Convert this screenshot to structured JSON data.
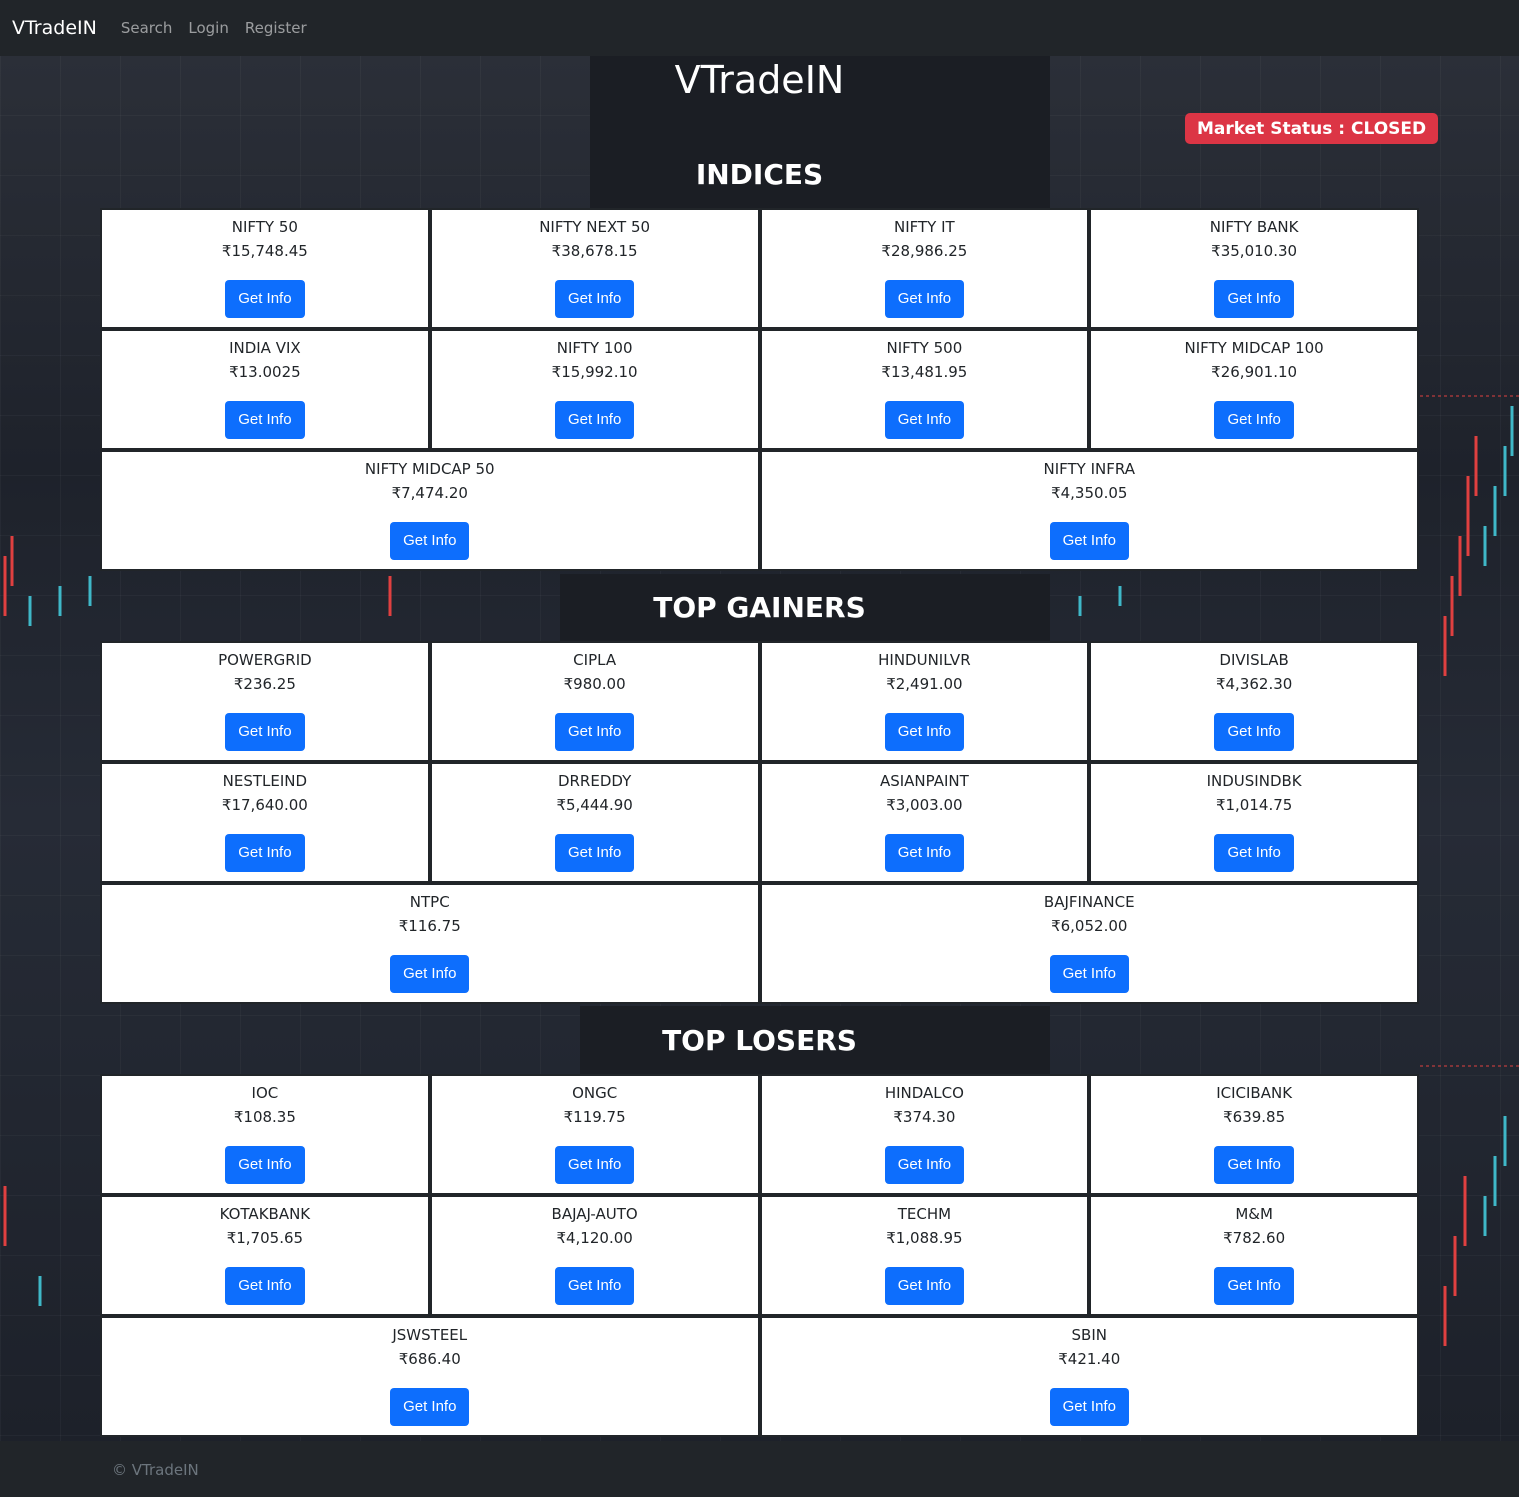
{
  "navbar": {
    "brand": "VTradeIN",
    "links": [
      "Search",
      "Login",
      "Register"
    ]
  },
  "header": {
    "title": "VTradeIN",
    "market_status": "Market Status : CLOSED",
    "market_status_color": "#dc3545"
  },
  "button_label": "Get Info",
  "colors": {
    "button": "#0d6efd",
    "dark": "#212529"
  },
  "sections": [
    {
      "title": "INDICES",
      "items": [
        {
          "name": "NIFTY 50",
          "price": "₹15,748.45"
        },
        {
          "name": "NIFTY NEXT 50",
          "price": "₹38,678.15"
        },
        {
          "name": "NIFTY IT",
          "price": "₹28,986.25"
        },
        {
          "name": "NIFTY BANK",
          "price": "₹35,010.30"
        },
        {
          "name": "INDIA VIX",
          "price": "₹13.0025"
        },
        {
          "name": "NIFTY 100",
          "price": "₹15,992.10"
        },
        {
          "name": "NIFTY 500",
          "price": "₹13,481.95"
        },
        {
          "name": "NIFTY MIDCAP 100",
          "price": "₹26,901.10"
        },
        {
          "name": "NIFTY MIDCAP 50",
          "price": "₹7,474.20"
        },
        {
          "name": "NIFTY INFRA",
          "price": "₹4,350.05"
        }
      ]
    },
    {
      "title": "TOP GAINERS",
      "items": [
        {
          "name": "POWERGRID",
          "price": "₹236.25"
        },
        {
          "name": "CIPLA",
          "price": "₹980.00"
        },
        {
          "name": "HINDUNILVR",
          "price": "₹2,491.00"
        },
        {
          "name": "DIVISLAB",
          "price": "₹4,362.30"
        },
        {
          "name": "NESTLEIND",
          "price": "₹17,640.00"
        },
        {
          "name": "DRREDDY",
          "price": "₹5,444.90"
        },
        {
          "name": "ASIANPAINT",
          "price": "₹3,003.00"
        },
        {
          "name": "INDUSINDBK",
          "price": "₹1,014.75"
        },
        {
          "name": "NTPC",
          "price": "₹116.75"
        },
        {
          "name": "BAJFINANCE",
          "price": "₹6,052.00"
        }
      ]
    },
    {
      "title": "TOP LOSERS",
      "items": [
        {
          "name": "IOC",
          "price": "₹108.35"
        },
        {
          "name": "ONGC",
          "price": "₹119.75"
        },
        {
          "name": "HINDALCO",
          "price": "₹374.30"
        },
        {
          "name": "ICICIBANK",
          "price": "₹639.85"
        },
        {
          "name": "KOTAKBANK",
          "price": "₹1,705.65"
        },
        {
          "name": "BAJAJ-AUTO",
          "price": "₹4,120.00"
        },
        {
          "name": "TECHM",
          "price": "₹1,088.95"
        },
        {
          "name": "M&M",
          "price": "₹782.60"
        },
        {
          "name": "JSWSTEEL",
          "price": "₹686.40"
        },
        {
          "name": "SBIN",
          "price": "₹421.40"
        }
      ]
    }
  ],
  "footer": {
    "text": "© VTradeIN"
  }
}
